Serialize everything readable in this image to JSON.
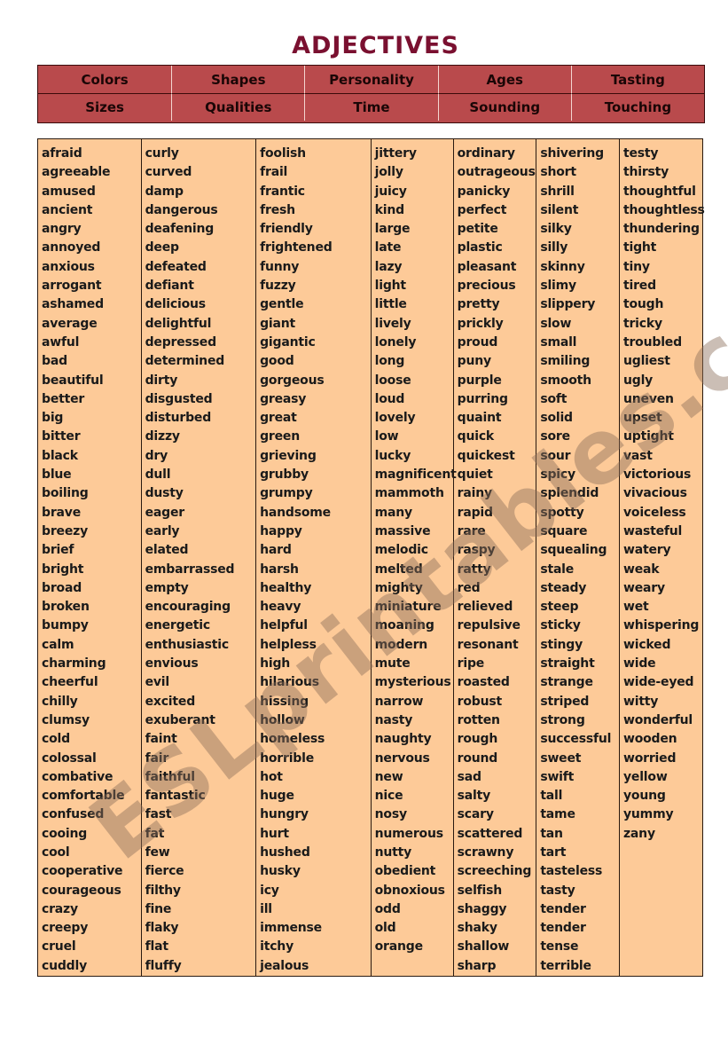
{
  "title": "ADJECTIVES",
  "categories": [
    [
      "Colors",
      "Shapes",
      "Personality",
      "Ages",
      "Tasting"
    ],
    [
      "Sizes",
      "Qualities",
      "Time",
      "Sounding",
      "Touching"
    ]
  ],
  "columns": [
    [
      "afraid",
      "agreeable",
      "amused",
      "ancient",
      "angry",
      "annoyed",
      "anxious",
      "arrogant",
      "ashamed",
      "average",
      "awful",
      "bad",
      "beautiful",
      "better",
      "big",
      "bitter",
      "black",
      "blue",
      "boiling",
      "brave",
      "breezy",
      "brief",
      "bright",
      "broad",
      "broken",
      "bumpy",
      "calm",
      "charming",
      "cheerful",
      "chilly",
      "clumsy",
      "cold",
      "colossal",
      "combative",
      "comfortable",
      "confused",
      "cooing",
      "cool",
      "cooperative",
      "courageous",
      "crazy",
      "creepy",
      "cruel",
      "cuddly"
    ],
    [
      "curly",
      "curved",
      "damp",
      "dangerous",
      "deafening",
      "deep",
      "defeated",
      "defiant",
      "delicious",
      "delightful",
      "depressed",
      "determined",
      "dirty",
      "disgusted",
      "disturbed",
      "dizzy",
      "dry",
      "dull",
      "dusty",
      "eager",
      "early",
      "elated",
      "embarrassed",
      "empty",
      "encouraging",
      "energetic",
      "enthusiastic",
      "envious",
      "evil",
      "excited",
      "exuberant",
      "faint",
      "fair",
      "faithful",
      "fantastic",
      "fast",
      "fat",
      "few",
      "fierce",
      "filthy",
      "fine",
      "flaky",
      "flat",
      "fluffy"
    ],
    [
      "foolish",
      "frail",
      "frantic",
      "fresh",
      "friendly",
      "frightened",
      "funny",
      "fuzzy",
      "gentle",
      "giant",
      "gigantic",
      "good",
      "gorgeous",
      "greasy",
      "great",
      "green",
      "grieving",
      "grubby",
      "grumpy",
      "handsome",
      "happy",
      "hard",
      "harsh",
      "healthy",
      "heavy",
      "helpful",
      "helpless",
      "high",
      "hilarious",
      "hissing",
      "hollow",
      "homeless",
      "horrible",
      "hot",
      "huge",
      "hungry",
      "hurt",
      "hushed",
      "husky",
      "icy",
      "ill",
      "immense",
      "itchy",
      "jealous"
    ],
    [
      "jittery",
      "jolly",
      "juicy",
      "kind",
      "large",
      "late",
      "lazy",
      "light",
      "little",
      "lively",
      "lonely",
      "long",
      "loose",
      "loud",
      "lovely",
      "low",
      "lucky",
      "magnificent",
      "mammoth",
      "many",
      "massive",
      "melodic",
      "melted",
      "mighty",
      "miniature",
      "moaning",
      "modern",
      "mute",
      "mysterious",
      "narrow",
      "nasty",
      "naughty",
      "nervous",
      "new",
      "nice",
      "nosy",
      "numerous",
      "nutty",
      "obedient",
      "obnoxious",
      "odd",
      "old",
      "orange"
    ],
    [
      "ordinary",
      "outrageous",
      "panicky",
      "perfect",
      "petite",
      "plastic",
      "pleasant",
      "precious",
      "pretty",
      "prickly",
      "proud",
      "puny",
      "purple",
      "purring",
      "quaint",
      "quick",
      "quickest",
      "quiet",
      "rainy",
      "rapid",
      "rare",
      "raspy",
      "ratty",
      "red",
      "relieved",
      "repulsive",
      "resonant",
      "ripe",
      "roasted",
      "robust",
      "rotten",
      "rough",
      "round",
      "sad",
      "salty",
      "scary",
      "scattered",
      "scrawny",
      "screeching",
      "selfish",
      "shaggy",
      "shaky",
      "shallow",
      "sharp"
    ],
    [
      "shivering",
      "short",
      "shrill",
      "silent",
      "silky",
      "silly",
      "skinny",
      "slimy",
      "slippery",
      "slow",
      "small",
      "smiling",
      "smooth",
      "soft",
      "solid",
      "sore",
      "sour",
      "spicy",
      "splendid",
      "spotty",
      "square",
      "squealing",
      "stale",
      "steady",
      "steep",
      "sticky",
      "stingy",
      "straight",
      "strange",
      "striped",
      "strong",
      "successful",
      "sweet",
      "swift",
      "tall",
      "tame",
      "tan",
      "tart",
      "tasteless",
      "tasty",
      "tender",
      "tender",
      "tense",
      "terrible"
    ],
    [
      "testy",
      "thirsty",
      "thoughtful",
      "thoughtless",
      "thundering",
      "tight",
      "tiny",
      "tired",
      "tough",
      "tricky",
      "troubled",
      "ugliest",
      "ugly",
      "uneven",
      "upset",
      "uptight",
      "vast",
      "victorious",
      "vivacious",
      "voiceless",
      "wasteful",
      "watery",
      "weak",
      "weary",
      "wet",
      "whispering",
      "wicked",
      "wide",
      "wide-eyed",
      "witty",
      "wonderful",
      "wooden",
      "worried",
      "yellow",
      "young",
      "yummy",
      "zany"
    ]
  ],
  "watermark": "ESLprintables.com"
}
